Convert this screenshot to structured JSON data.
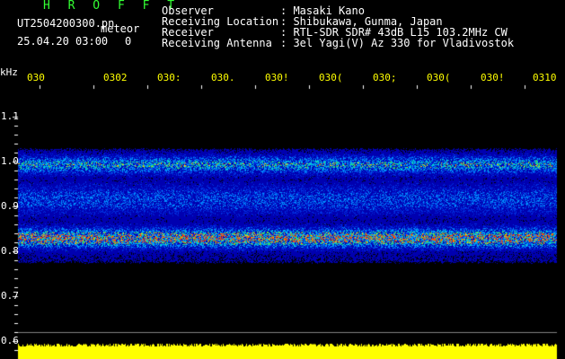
{
  "header": {
    "app_title": "H R O F F T",
    "filename": "UT2504200300.pn",
    "mode": "meteor",
    "datetime": "25.04.20 03:00",
    "count": "0",
    "info_labels": [
      "Observer",
      "Receiving Location",
      "Receiver",
      "Receiving Antenna"
    ],
    "info_values": [
      ": Masaki Kano",
      ": Shibukawa, Gunma, Japan",
      ": RTL-SDR SDR# 43dB L15 103.2MHz CW",
      ": 3el Yagi(V) Az 330 for Vladivostok"
    ]
  },
  "axis": {
    "unit": "kHz",
    "time_labels": [
      "030",
      "0302",
      "030:",
      "030.",
      "030!",
      "030(",
      "030;",
      "030(",
      "030!",
      "0310"
    ],
    "freq_labels": [
      "1.1",
      "1.0",
      "0.9",
      "0.8",
      "0.7",
      "0.6"
    ]
  },
  "colors": {
    "background": "#000000",
    "title": "#33ff33",
    "time_label": "#ffff00",
    "amplitude_bar": "#ffff00",
    "spectrum_low": "#0000aa",
    "spectrum_mid": "#00ccff",
    "spectrum_high": "#ffcc00"
  }
}
